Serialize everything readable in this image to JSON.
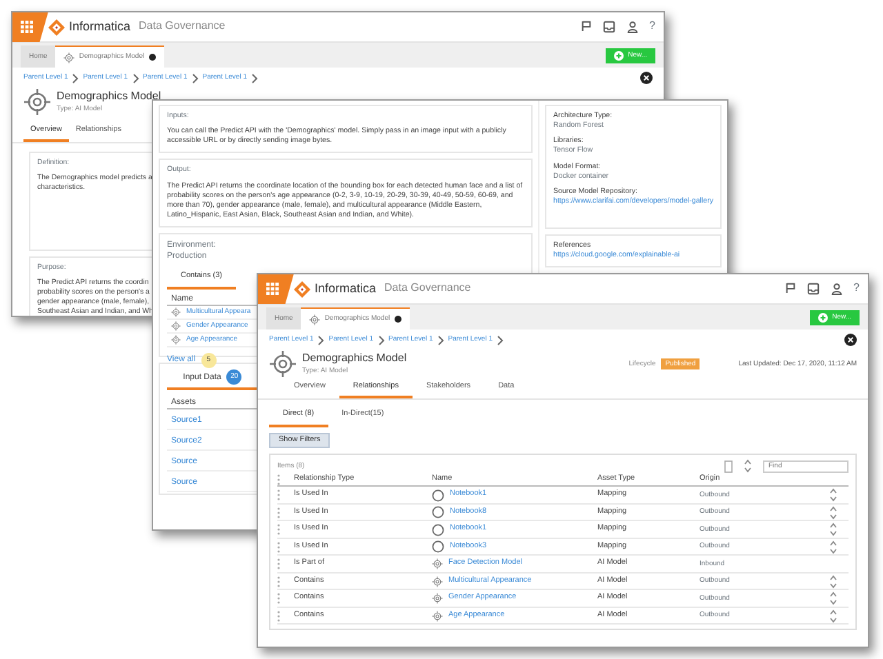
{
  "back_window": {
    "header": {
      "brand": "Informatica",
      "product": "Data Governance",
      "help": "?"
    },
    "tabs": [
      {
        "label": "Home",
        "selected": false
      },
      {
        "label": "Demographics Model",
        "selected": true
      }
    ],
    "new_button": "New...",
    "breadcrumbs": [
      "Parent Level 1",
      "Parent Level 1",
      "Parent Level 1",
      "Parent Level 1"
    ],
    "title": "Demographics Model",
    "type": "Type: AI Model",
    "page_tabs": [
      {
        "label": "Overview",
        "selected": true
      },
      {
        "label": "Relationships",
        "selected": false
      }
    ],
    "definition": {
      "label": "Definition:",
      "lines": [
        "The Demographics model predicts a",
        "characteristics."
      ]
    },
    "purpose": {
      "label": "Purpose:",
      "lines": [
        "The Predict API returns the coordin",
        "probability scores on the person's a",
        "gender appearance (male, female),",
        "Southeast Asian and Indian, and Wh"
      ]
    }
  },
  "middle_window": {
    "inputs": {
      "label": "Inputs:",
      "text": "You can call the Predict API with the 'Demographics' model. Simply pass in an image input with a publicly accessible URL or by directly sending image bytes."
    },
    "output": {
      "label": "Output:",
      "text": "The Predict API returns the coordinate location of the bounding box for each detected human face and a list of probability scores on the person's age appearance (0-2, 3-9, 10-19, 20-29, 30-39, 40-49, 50-59, 60-69, and more than 70), gender appearance (male, female), and multicultural appearance (Middle Eastern, Latino_Hispanic, East Asian, Black, Southeast Asian and Indian, and White)."
    },
    "properties": [
      {
        "label": "Architecture Type:",
        "value": "Random Forest",
        "kind": "text"
      },
      {
        "label": "Libraries:",
        "value": "Tensor Flow",
        "kind": "text"
      },
      {
        "label": "Model Format:",
        "value": "Docker container",
        "kind": "text"
      },
      {
        "label": "Source Model Repository:",
        "value": "https://www.clarifai.com/developers/model-gallery",
        "kind": "link"
      }
    ],
    "references": {
      "label": "References",
      "link": "https://cloud.google.com/explainable-ai"
    },
    "environment": {
      "label": "Environment:",
      "value": "Production"
    },
    "contains_tabs": [
      {
        "label": "Contains (3)",
        "selected": true
      }
    ],
    "contains_header": "Name",
    "contains": [
      "Multicultural Appeara",
      "Gender Appearance",
      "Age Appearance"
    ],
    "view_all": {
      "label": "View all",
      "count": "5"
    },
    "input_data": {
      "label": "Input Data",
      "count": "20",
      "header": "Assets",
      "rows": [
        "Source1",
        "Source2",
        "Source",
        "Source"
      ]
    }
  },
  "front_window": {
    "header": {
      "brand": "Informatica",
      "product": "Data Governance",
      "help": "?"
    },
    "tabs": [
      {
        "label": "Home",
        "selected": false
      },
      {
        "label": "Demographics Model",
        "selected": true
      }
    ],
    "new_button": "New...",
    "breadcrumbs": [
      "Parent Level 1",
      "Parent Level 1",
      "Parent Level 1",
      "Parent Level 1"
    ],
    "title": "Demographics Model",
    "type": "Type: AI Model",
    "lifecycle": {
      "label": "Lifecycle",
      "status": "Published"
    },
    "last_updated": "Last Updated: Dec 17, 2020, 11:12 AM",
    "page_tabs": [
      {
        "label": "Overview",
        "selected": false
      },
      {
        "label": "Relationships",
        "selected": true
      },
      {
        "label": "Stakeholders",
        "selected": false
      },
      {
        "label": "Data",
        "selected": false
      }
    ],
    "sub_tabs": [
      {
        "label": "Direct (8)",
        "selected": true
      },
      {
        "label": "In-Direct(15)",
        "selected": false
      }
    ],
    "filter_button": "Show Filters",
    "items_count": "Items (8)",
    "find": {
      "placeholder": "Find"
    },
    "columns": [
      "Relationship Type",
      "Name",
      "Asset Type",
      "Origin"
    ],
    "rows": [
      {
        "relationship": "Is Used In",
        "name": "Notebook1",
        "asset_type": "Mapping",
        "origin": "Outbound",
        "kind": "notebook",
        "action": true
      },
      {
        "relationship": "Is Used In",
        "name": "Notebook8",
        "asset_type": "Mapping",
        "origin": "Outbound",
        "kind": "notebook",
        "action": true
      },
      {
        "relationship": "Is Used In",
        "name": "Notebook1",
        "asset_type": "Mapping",
        "origin": "Outbound",
        "kind": "notebook",
        "action": true
      },
      {
        "relationship": "Is Used In",
        "name": "Notebook3",
        "asset_type": "Mapping",
        "origin": "Outbound",
        "kind": "notebook",
        "action": true
      },
      {
        "relationship": "Is Part of",
        "name": "Face Detection Model",
        "asset_type": "AI Model",
        "origin": "Inbound",
        "kind": "model",
        "action": false
      },
      {
        "relationship": "Contains",
        "name": "Multicultural Appearance",
        "asset_type": "AI Model",
        "origin": "Outbound",
        "kind": "model",
        "action": true
      },
      {
        "relationship": "Contains",
        "name": "Gender Appearance",
        "asset_type": "AI Model",
        "origin": "Outbound",
        "kind": "model",
        "action": true
      },
      {
        "relationship": "Contains",
        "name": "Age Appearance",
        "asset_type": "AI Model",
        "origin": "Outbound",
        "kind": "model",
        "action": true
      }
    ]
  }
}
